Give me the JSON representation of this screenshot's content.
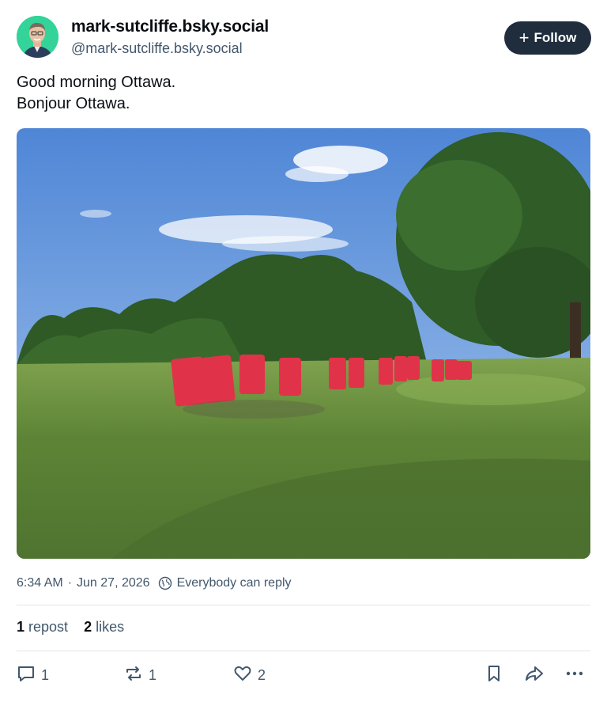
{
  "author": {
    "display_name": "mark-sutcliffe.bsky.social",
    "handle": "@mark-sutcliffe.bsky.social"
  },
  "follow_button": {
    "label": "Follow",
    "icon": "plus-icon"
  },
  "post": {
    "lines": [
      "Good morning Ottawa.",
      "Bonjour Ottawa."
    ],
    "image": {
      "icon": "photo-of-red-adirondack-chairs-on-lawn"
    },
    "timestamp": "6:34 AM",
    "separator": "·",
    "date": "Jun 27, 2026",
    "reply_setting": "Everybody can reply"
  },
  "stats": {
    "reposts_count": "1",
    "reposts_label": "repost",
    "likes_count": "2",
    "likes_label": "likes"
  },
  "actions": {
    "reply_count": "1",
    "repost_count": "1",
    "like_count": "2"
  },
  "colors": {
    "follow_bg": "#1f2d3d",
    "muted": "#42576c",
    "avatar_bg": "#34d399"
  }
}
